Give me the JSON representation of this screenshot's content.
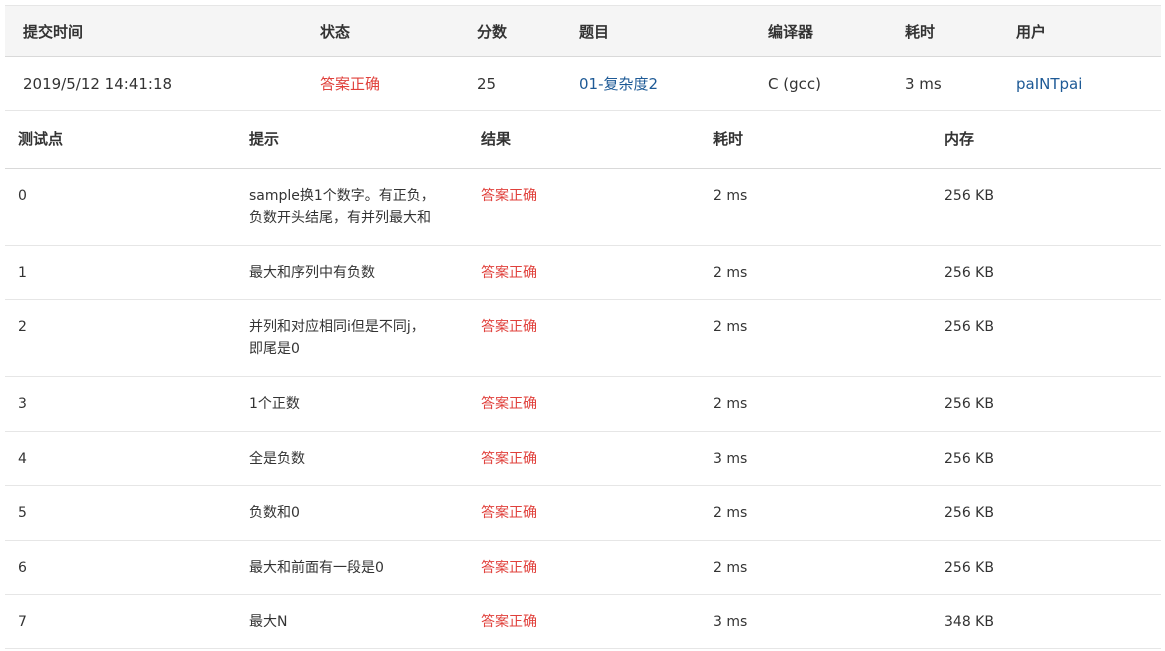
{
  "submission": {
    "headers": [
      "提交时间",
      "状态",
      "分数",
      "题目",
      "编译器",
      "耗时",
      "用户"
    ],
    "time": "2019/5/12 14:41:18",
    "status": "答案正确",
    "score": "25",
    "problem": "01-复杂度2",
    "compiler": "C (gcc)",
    "elapsed": "3 ms",
    "user": "paINTpai"
  },
  "cases": {
    "headers": [
      "测试点",
      "提示",
      "结果",
      "耗时",
      "内存"
    ],
    "rows": [
      {
        "id": "0",
        "hint": "sample换1个数字。有正负，\n负数开头结尾，有并列最大和",
        "result": "答案正确",
        "time": "2 ms",
        "mem": "256 KB"
      },
      {
        "id": "1",
        "hint": "最大和序列中有负数",
        "result": "答案正确",
        "time": "2 ms",
        "mem": "256 KB"
      },
      {
        "id": "2",
        "hint": "并列和对应相同i但是不同j，\n即尾是0",
        "result": "答案正确",
        "time": "2 ms",
        "mem": "256 KB"
      },
      {
        "id": "3",
        "hint": "1个正数",
        "result": "答案正确",
        "time": "2 ms",
        "mem": "256 KB"
      },
      {
        "id": "4",
        "hint": "全是负数",
        "result": "答案正确",
        "time": "3 ms",
        "mem": "256 KB"
      },
      {
        "id": "5",
        "hint": "负数和0",
        "result": "答案正确",
        "time": "2 ms",
        "mem": "256 KB"
      },
      {
        "id": "6",
        "hint": "最大和前面有一段是0",
        "result": "答案正确",
        "time": "2 ms",
        "mem": "256 KB"
      },
      {
        "id": "7",
        "hint": "最大N",
        "result": "答案正确",
        "time": "3 ms",
        "mem": "348 KB"
      }
    ]
  },
  "colors": {
    "accepted": "#e0403b",
    "link": "#1e5a96"
  }
}
